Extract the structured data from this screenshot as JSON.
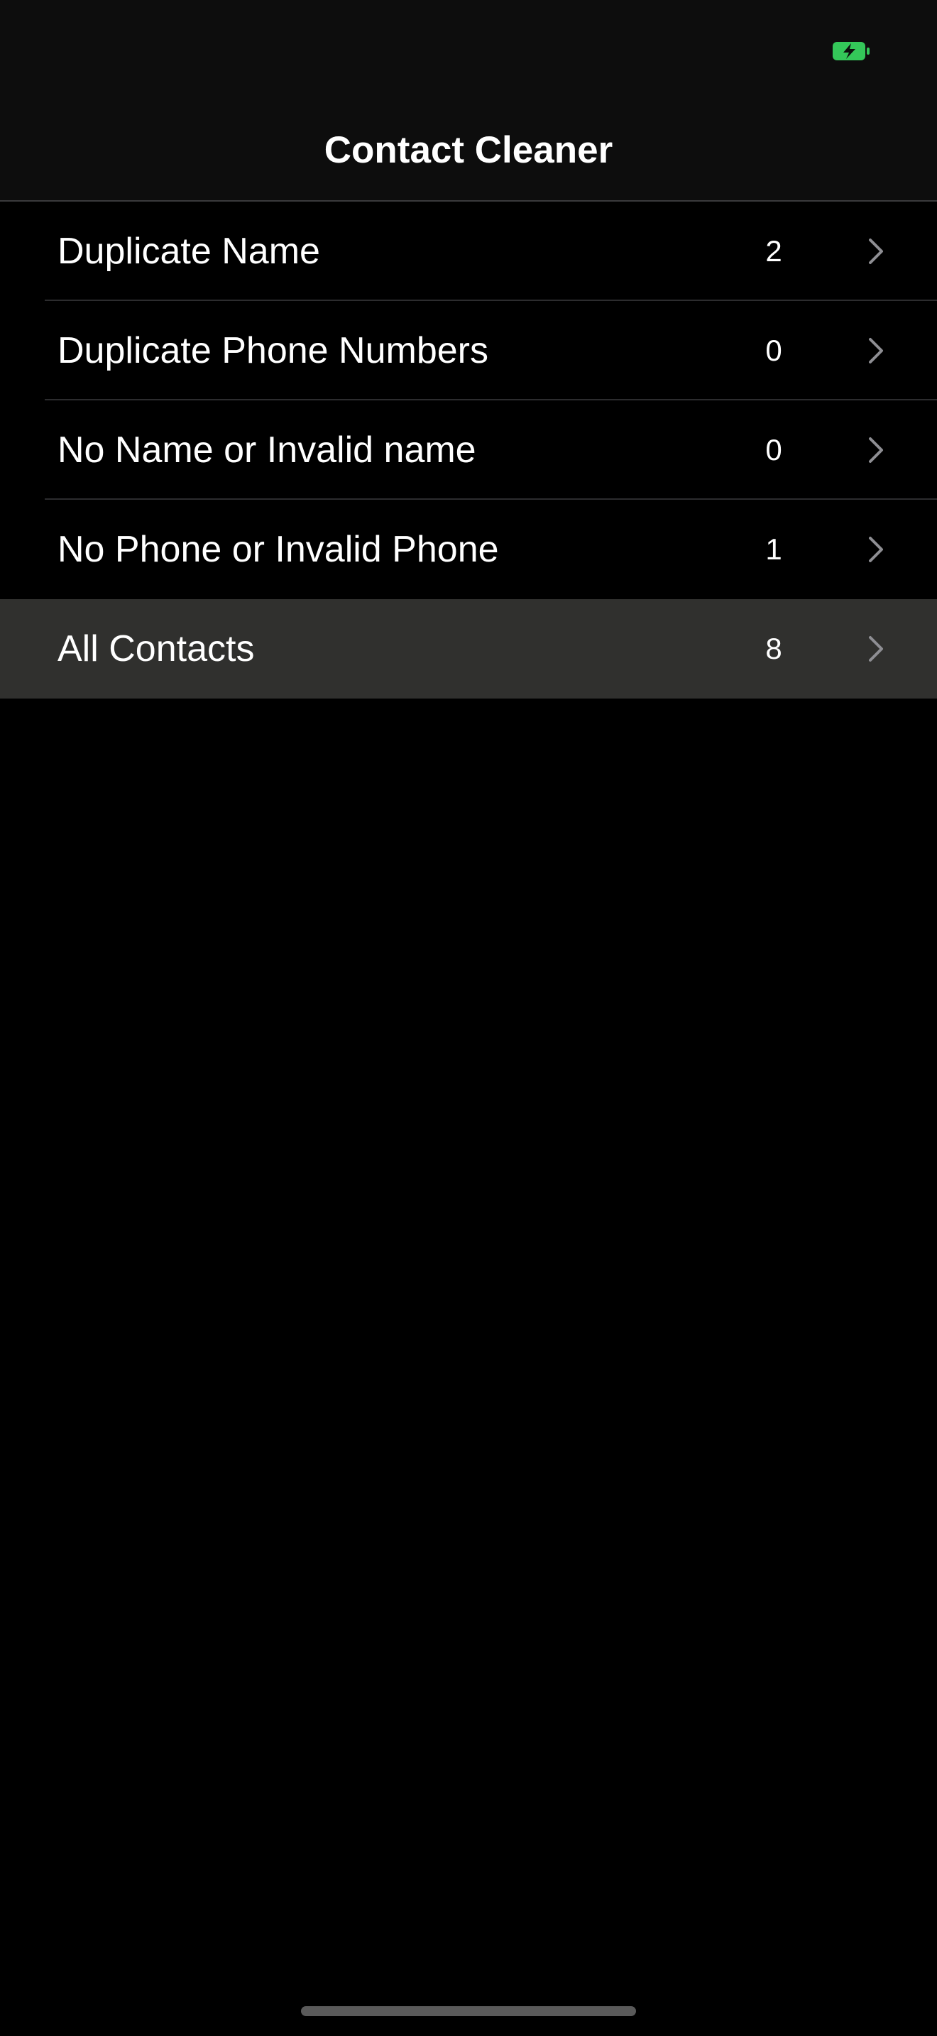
{
  "status_bar": {
    "battery_icon": "battery-charging-icon",
    "battery_color": "#34c759"
  },
  "header": {
    "title": "Contact Cleaner"
  },
  "rows": [
    {
      "label": "Duplicate Name",
      "count": "2",
      "icon": "chevron-right-icon"
    },
    {
      "label": "Duplicate Phone Numbers",
      "count": "0",
      "icon": "chevron-right-icon"
    },
    {
      "label": "No Name or Invalid name",
      "count": "0",
      "icon": "chevron-right-icon"
    },
    {
      "label": "No Phone or Invalid Phone",
      "count": "1",
      "icon": "chevron-right-icon"
    },
    {
      "label": "All Contacts",
      "count": "8",
      "icon": "chevron-right-icon",
      "highlighted": true
    }
  ],
  "colors": {
    "background": "#000000",
    "highlight": "#30302e",
    "chevron": "#8e8e93"
  }
}
